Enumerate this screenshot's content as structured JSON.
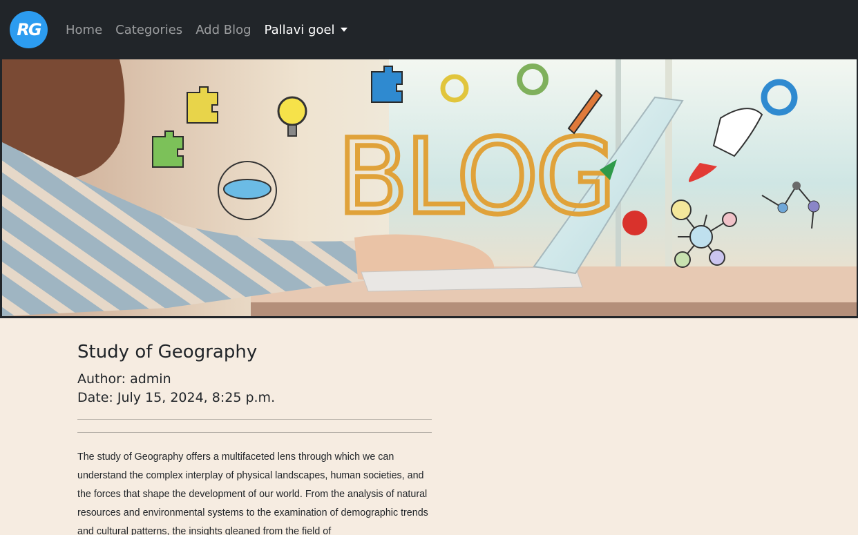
{
  "navbar": {
    "logo_text": "RG",
    "links": [
      {
        "label": "Home"
      },
      {
        "label": "Categories"
      },
      {
        "label": "Add Blog"
      }
    ],
    "user_menu_label": "Pallavi goel"
  },
  "banner": {
    "headline": "BLOG"
  },
  "post": {
    "title": "Study of Geography",
    "author": "Author: admin",
    "date": "Date: July 15, 2024, 8:25 p.m.",
    "body": "The study of Geography offers a multifaceted lens through which we can understand the complex interplay of physical landscapes, human societies, and the forces that shape the development of our world. From the analysis of natural resources and environmental systems to the examination of demographic trends and cultural patterns, the insights gleaned from the field of"
  },
  "colors": {
    "navbar_bg": "#212529",
    "page_bg": "#f6ece1",
    "logo_bg": "#2c9cf0",
    "blog_text": "#e0a23a"
  }
}
